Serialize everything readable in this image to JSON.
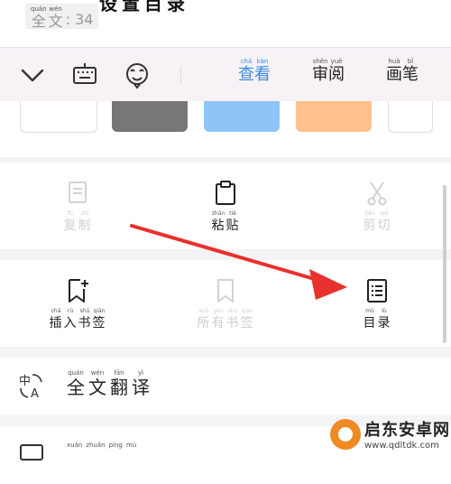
{
  "header": {
    "word_count": {
      "label_chars": [
        {
          "py": "quán",
          "hz": "全"
        },
        {
          "py": "wén",
          "hz": "文"
        }
      ],
      "colon": ":",
      "value": "34"
    },
    "title_chars": [
      "设",
      "置",
      "目",
      "录"
    ]
  },
  "toolbar": {
    "icons": [
      "chevron-down-icon",
      "keyboard-icon",
      "emoji-icon"
    ],
    "tabs": [
      {
        "chars": [
          {
            "py": "chá",
            "hz": "查"
          },
          {
            "py": "kàn",
            "hz": "看"
          }
        ],
        "active": true
      },
      {
        "chars": [
          {
            "py": "shěn",
            "hz": "审"
          },
          {
            "py": "yuè",
            "hz": "阅"
          }
        ],
        "active": false
      },
      {
        "chars": [
          {
            "py": "huà",
            "hz": "画"
          },
          {
            "py": "bǐ",
            "hz": "笔"
          }
        ],
        "active": false
      }
    ]
  },
  "swatches": [
    "#ffffff",
    "#777777",
    "#8ec4f6",
    "#ffc28c",
    "#ffffff"
  ],
  "edit_actions": [
    {
      "chars": [
        {
          "py": "fù",
          "hz": "复"
        },
        {
          "py": "zhì",
          "hz": "制"
        }
      ],
      "enabled": false,
      "icon": "copy-icon"
    },
    {
      "chars": [
        {
          "py": "zhān",
          "hz": "粘"
        },
        {
          "py": "tiē",
          "hz": "贴"
        }
      ],
      "enabled": true,
      "icon": "paste-icon"
    },
    {
      "chars": [
        {
          "py": "jiǎn",
          "hz": "剪"
        },
        {
          "py": "qiē",
          "hz": "切"
        }
      ],
      "enabled": false,
      "icon": "scissors-icon"
    }
  ],
  "bookmark_actions": [
    {
      "chars": [
        {
          "py": "chā",
          "hz": "插"
        },
        {
          "py": "rù",
          "hz": "入"
        },
        {
          "py": "shū",
          "hz": "书"
        },
        {
          "py": "qiān",
          "hz": "签"
        }
      ],
      "enabled": true,
      "icon": "bookmark-add-icon"
    },
    {
      "chars": [
        {
          "py": "suǒ",
          "hz": "所"
        },
        {
          "py": "yǒu",
          "hz": "有"
        },
        {
          "py": "shū",
          "hz": "书"
        },
        {
          "py": "qiān",
          "hz": "签"
        }
      ],
      "enabled": false,
      "icon": "bookmark-icon"
    },
    {
      "chars": [
        {
          "py": "mù",
          "hz": "目"
        },
        {
          "py": "lù",
          "hz": "录"
        }
      ],
      "enabled": true,
      "icon": "table-of-contents-icon"
    }
  ],
  "menu_rows": [
    {
      "chars": [
        {
          "py": "quán",
          "hz": "全"
        },
        {
          "py": "wén",
          "hz": "文"
        },
        {
          "py": "fān",
          "hz": "翻"
        },
        {
          "py": "yì",
          "hz": "译"
        }
      ],
      "icon": "translate-icon"
    },
    {
      "chars": [
        {
          "py": "xuǎn",
          "hz": ""
        },
        {
          "py": "zhuǎn",
          "hz": ""
        },
        {
          "py": "píng",
          "hz": ""
        },
        {
          "py": "mù",
          "hz": ""
        }
      ],
      "icon": "screen-icon"
    }
  ],
  "watermark": {
    "title": "启东安卓网",
    "url": "www.qdltdk.com"
  },
  "colors": {
    "accent": "#3a8be0",
    "arrow": "#e8302c",
    "disabled": "#cfcfcf"
  }
}
